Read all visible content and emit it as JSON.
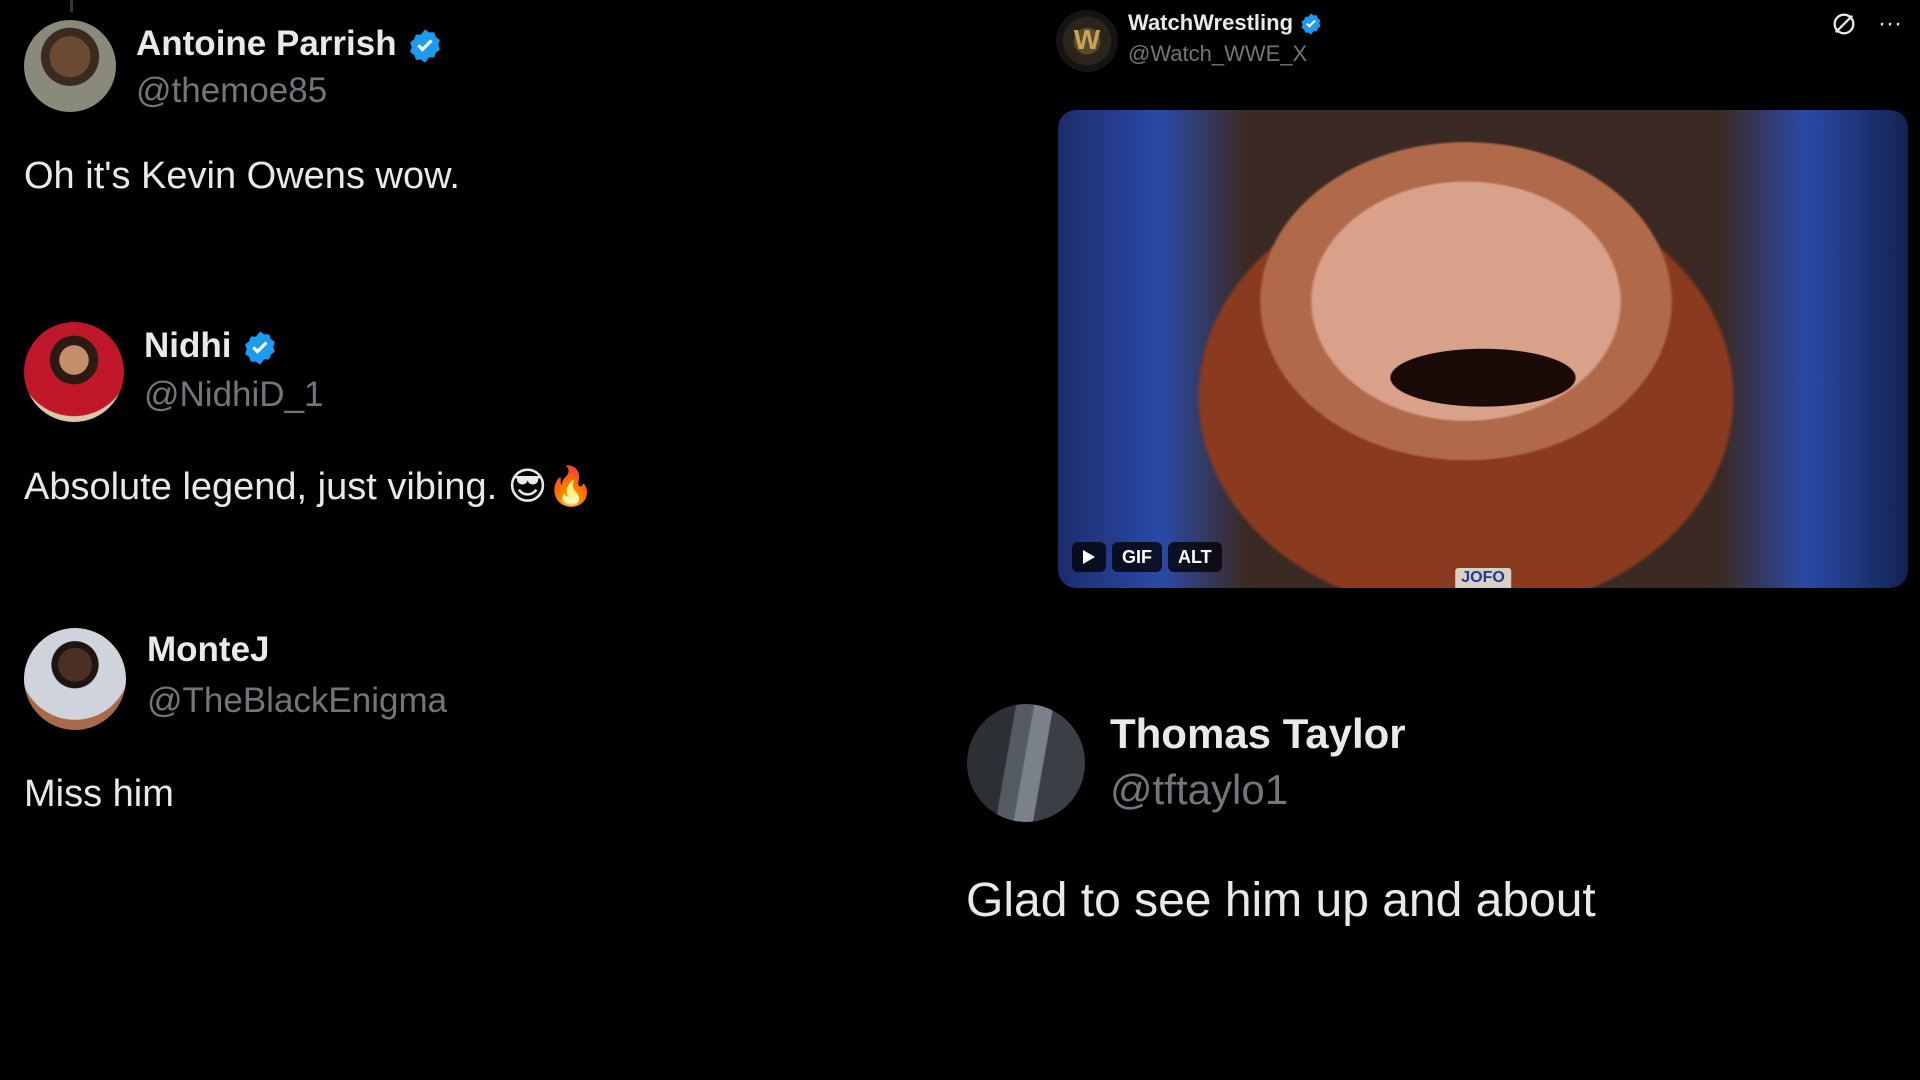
{
  "colors": {
    "background": "#000000",
    "text": "#e7e9ea",
    "secondary": "#71767b",
    "verified": "#1d9bf0"
  },
  "replies": [
    {
      "name": "Antoine Parrish",
      "handle": "@themoe85",
      "text": "Oh it's Kevin Owens wow.",
      "verified": true
    },
    {
      "name": "Nidhi",
      "handle": "@NidhiD_1",
      "text": "Absolute legend, just vibing. 😎🔥",
      "verified": true
    },
    {
      "name": "MonteJ",
      "handle": "@TheBlackEnigma",
      "text": "Miss him",
      "verified": false
    },
    {
      "name": "Thomas Taylor",
      "handle": "@tftaylo1",
      "text": "Glad to see him up and about",
      "verified": false
    }
  ],
  "main_post": {
    "name": "WatchWrestling",
    "handle": "@Watch_WWE_X",
    "verified": true,
    "icons": [
      "grok-icon",
      "more-icon"
    ],
    "media": {
      "gif_label": "GIF",
      "alt_label": "ALT",
      "play_icon": "play-icon",
      "watermark": "JOFO"
    }
  }
}
